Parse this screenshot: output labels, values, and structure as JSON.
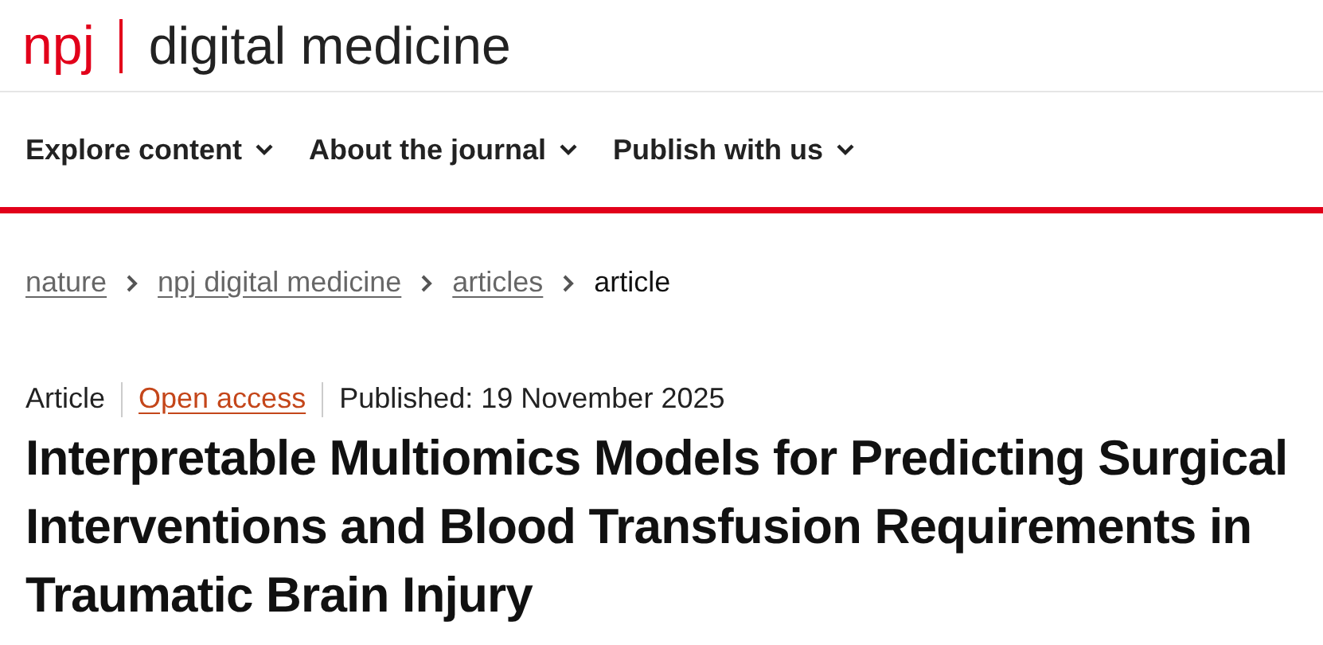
{
  "header": {
    "logo_mark": "npj",
    "journal_name": "digital medicine"
  },
  "nav": [
    {
      "label": "Explore content"
    },
    {
      "label": "About the journal"
    },
    {
      "label": "Publish with us"
    }
  ],
  "breadcrumbs": [
    {
      "label": "nature",
      "current": false
    },
    {
      "label": "npj digital medicine",
      "current": false
    },
    {
      "label": "articles",
      "current": false
    },
    {
      "label": "article",
      "current": true
    }
  ],
  "article": {
    "type": "Article",
    "access": "Open access",
    "published": "Published: 19 November 2025",
    "title": "Interpretable Multiomics Models for Predicting Surgical Interventions and Blood Transfusion Requirements in Traumatic Brain Injury"
  }
}
